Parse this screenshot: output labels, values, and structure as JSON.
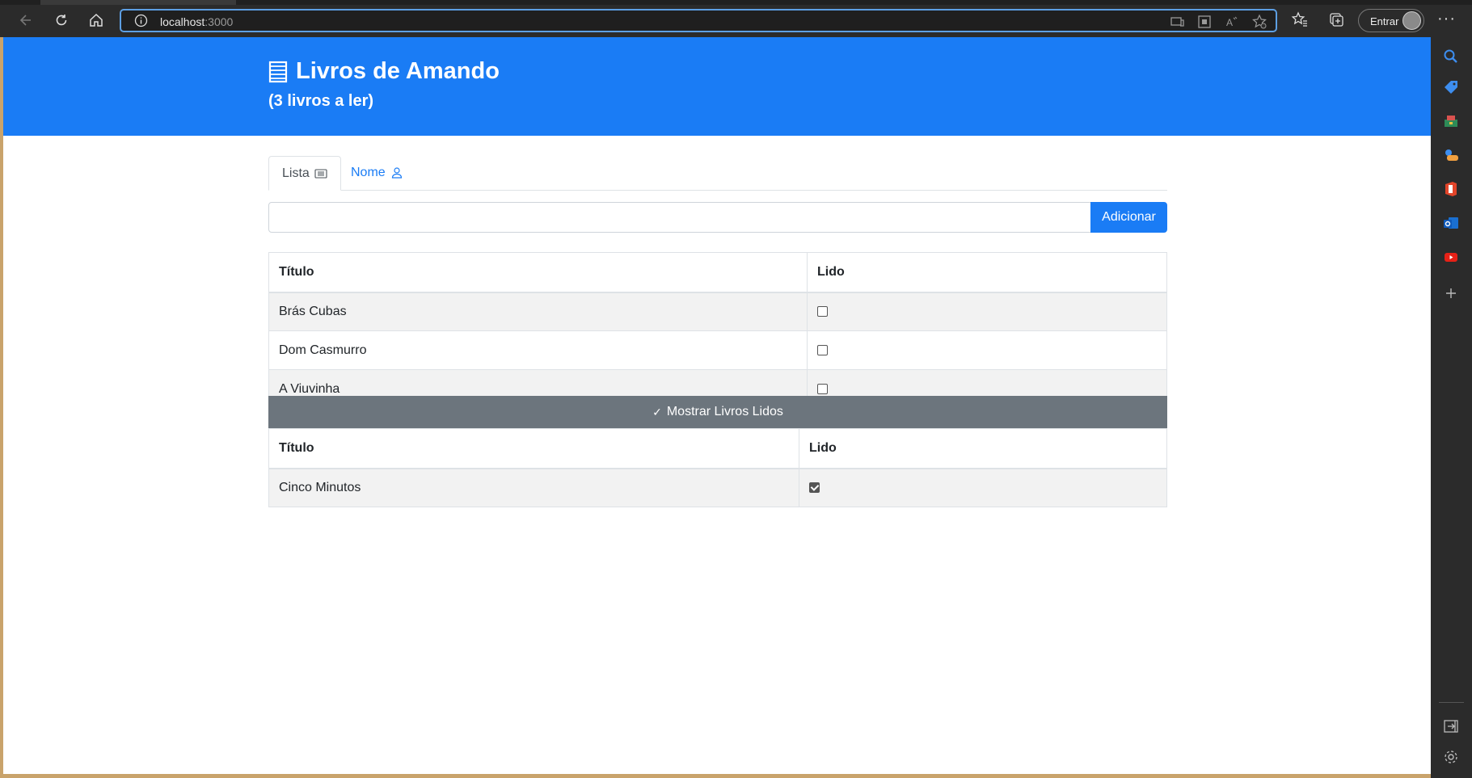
{
  "browser": {
    "url_host": "localhost",
    "url_port": ":3000",
    "signin_label": "Entrar",
    "more_label": "···"
  },
  "page": {
    "title": "Livros de Amando",
    "subtitle": "(3 livros a ler)",
    "accent_color": "#1a7cf5"
  },
  "tabs": {
    "list_label": "Lista",
    "name_label": "Nome"
  },
  "form": {
    "input_value": "",
    "add_label": "Adicionar"
  },
  "unread_table": {
    "headers": [
      "Título",
      "Lido"
    ],
    "rows": [
      {
        "title": "Brás Cubas",
        "read": false
      },
      {
        "title": "Dom Casmurro",
        "read": false
      },
      {
        "title": "A Viuvinha",
        "read": false
      }
    ]
  },
  "show_read_button": {
    "label": "Mostrar Livros Lidos",
    "icon": "check-icon"
  },
  "read_table": {
    "headers": [
      "Título",
      "Lido"
    ],
    "rows": [
      {
        "title": "Cinco Minutos",
        "read": true
      }
    ]
  }
}
